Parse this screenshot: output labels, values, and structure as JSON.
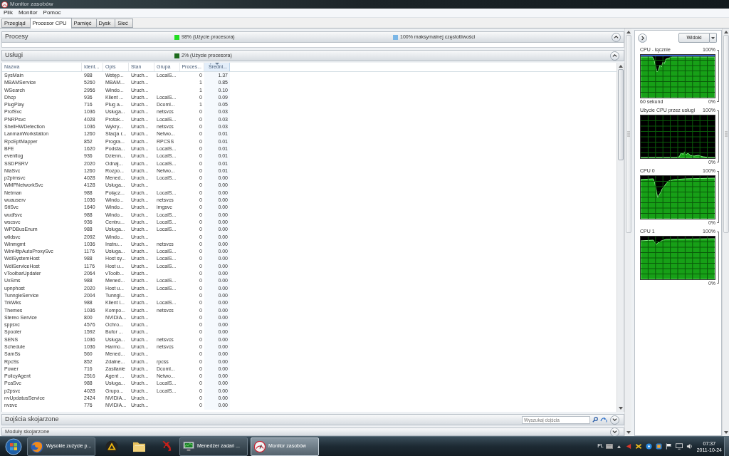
{
  "window": {
    "title": "Monitor zasobów"
  },
  "menu": [
    "Plik",
    "Monitor",
    "Pomoc"
  ],
  "tabs": [
    {
      "label": "Przegląd",
      "selected": false
    },
    {
      "label": "Procesor CPU",
      "selected": true
    },
    {
      "label": "Pamięć",
      "selected": false
    },
    {
      "label": "Dysk",
      "selected": false
    },
    {
      "label": "Sieć",
      "selected": false
    }
  ],
  "processes": {
    "title": "Procesy",
    "expanded": true,
    "legend": [
      {
        "text": "98% (Użycie procesora)",
        "color": "#22dd22"
      },
      {
        "text": "100% maksymalnej częstotliwości",
        "color": "#7ab6e6"
      }
    ]
  },
  "services": {
    "title": "Usługi",
    "expanded": true,
    "legend": [
      {
        "text": "2% (Użycie procesora)",
        "color": "#1d6b1d"
      }
    ],
    "columns": [
      {
        "label": "Nazwa",
        "sorted": false
      },
      {
        "label": "Ident...",
        "sorted": false
      },
      {
        "label": "Opis",
        "sorted": false
      },
      {
        "label": "Stan",
        "sorted": false
      },
      {
        "label": "Grupa",
        "sorted": false
      },
      {
        "label": "Proces...",
        "sorted": false
      },
      {
        "label": "Średni...",
        "sorted": true
      }
    ],
    "rows": [
      {
        "name": "SysMain",
        "ident": "988",
        "opis": "Wstęp...",
        "stan": "Uruch...",
        "grupa": "LocalS...",
        "proces": "0",
        "sredni": "1.37"
      },
      {
        "name": "MBAMService",
        "ident": "5260",
        "opis": "MBAM...",
        "stan": "Uruch...",
        "proces": "1",
        "sredni": "0.85"
      },
      {
        "name": "WSearch",
        "ident": "2956",
        "opis": "Windo...",
        "stan": "Uruch...",
        "proces": "1",
        "sredni": "0.10"
      },
      {
        "name": "Dhcp",
        "ident": "936",
        "opis": "Klient ...",
        "stan": "Uruch...",
        "grupa": "LocalS...",
        "proces": "0",
        "sredni": "0.09"
      },
      {
        "name": "PlugPlay",
        "ident": "716",
        "opis": "Plug a...",
        "stan": "Uruch...",
        "grupa": "Dcoml...",
        "proces": "1",
        "sredni": "0.05"
      },
      {
        "name": "ProfSvc",
        "ident": "1036",
        "opis": "Usługa...",
        "stan": "Uruch...",
        "grupa": "netsvcs",
        "proces": "0",
        "sredni": "0.03"
      },
      {
        "name": "PNRPsvc",
        "ident": "4028",
        "opis": "Protok...",
        "stan": "Uruch...",
        "grupa": "LocalS...",
        "proces": "0",
        "sredni": "0.03"
      },
      {
        "name": "ShellHWDetection",
        "ident": "1036",
        "opis": "Wykry...",
        "stan": "Uruch...",
        "grupa": "netsvcs",
        "proces": "0",
        "sredni": "0.03"
      },
      {
        "name": "LanmanWorkstation",
        "ident": "1260",
        "opis": "Stacja r...",
        "stan": "Uruch...",
        "grupa": "Netwo...",
        "proces": "0",
        "sredni": "0.01"
      },
      {
        "name": "RpcEptMapper",
        "ident": "852",
        "opis": "Progra...",
        "stan": "Uruch...",
        "grupa": "RPCSS",
        "proces": "0",
        "sredni": "0.01"
      },
      {
        "name": "BFE",
        "ident": "1620",
        "opis": "Podsta...",
        "stan": "Uruch...",
        "grupa": "LocalS...",
        "proces": "0",
        "sredni": "0.01"
      },
      {
        "name": "eventlog",
        "ident": "936",
        "opis": "Dzienn...",
        "stan": "Uruch...",
        "grupa": "LocalS...",
        "proces": "0",
        "sredni": "0.01"
      },
      {
        "name": "SSDPSRV",
        "ident": "2020",
        "opis": "Odnaj...",
        "stan": "Uruch...",
        "grupa": "LocalS...",
        "proces": "0",
        "sredni": "0.01"
      },
      {
        "name": "NlaSvc",
        "ident": "1260",
        "opis": "Rozpo...",
        "stan": "Uruch...",
        "grupa": "Netwo...",
        "proces": "0",
        "sredni": "0.01"
      },
      {
        "name": "p2pimsvc",
        "ident": "4028",
        "opis": "Mened...",
        "stan": "Uruch...",
        "grupa": "LocalS...",
        "proces": "0",
        "sredni": "0.00"
      },
      {
        "name": "WMPNetworkSvc",
        "ident": "4128",
        "opis": "Usługa...",
        "stan": "Uruch...",
        "proces": "0",
        "sredni": "0.00"
      },
      {
        "name": "Netman",
        "ident": "988",
        "opis": "Połącz...",
        "stan": "Uruch...",
        "grupa": "LocalS...",
        "proces": "0",
        "sredni": "0.00"
      },
      {
        "name": "wuauserv",
        "ident": "1036",
        "opis": "Windo...",
        "stan": "Uruch...",
        "grupa": "netsvcs",
        "proces": "0",
        "sredni": "0.00"
      },
      {
        "name": "StiSvc",
        "ident": "1640",
        "opis": "Windo...",
        "stan": "Uruch...",
        "grupa": "imgsvc",
        "proces": "0",
        "sredni": "0.00"
      },
      {
        "name": "wudfsvc",
        "ident": "988",
        "opis": "Windo...",
        "stan": "Uruch...",
        "grupa": "LocalS...",
        "proces": "0",
        "sredni": "0.00"
      },
      {
        "name": "wscsvc",
        "ident": "936",
        "opis": "Centru...",
        "stan": "Uruch...",
        "grupa": "LocalS...",
        "proces": "0",
        "sredni": "0.00"
      },
      {
        "name": "WPDBusEnum",
        "ident": "988",
        "opis": "Usługa...",
        "stan": "Uruch...",
        "grupa": "LocalS...",
        "proces": "0",
        "sredni": "0.00"
      },
      {
        "name": "wlidsvc",
        "ident": "2092",
        "opis": "Windo...",
        "stan": "Uruch...",
        "proces": "0",
        "sredni": "0.00"
      },
      {
        "name": "Winmgmt",
        "ident": "1036",
        "opis": "Instru...",
        "stan": "Uruch...",
        "grupa": "netsvcs",
        "proces": "0",
        "sredni": "0.00"
      },
      {
        "name": "WinHttpAutoProxySvc",
        "ident": "1176",
        "opis": "Usługa...",
        "stan": "Uruch...",
        "grupa": "LocalS...",
        "proces": "0",
        "sredni": "0.00"
      },
      {
        "name": "WdiSystemHost",
        "ident": "988",
        "opis": "Host sy...",
        "stan": "Uruch...",
        "grupa": "LocalS...",
        "proces": "0",
        "sredni": "0.00"
      },
      {
        "name": "WdiServiceHost",
        "ident": "1176",
        "opis": "Host u...",
        "stan": "Uruch...",
        "grupa": "LocalS...",
        "proces": "0",
        "sredni": "0.00"
      },
      {
        "name": "vToolbarUpdater",
        "ident": "2064",
        "opis": "vToolb...",
        "stan": "Uruch...",
        "proces": "0",
        "sredni": "0.00"
      },
      {
        "name": "UxSms",
        "ident": "988",
        "opis": "Mened...",
        "stan": "Uruch...",
        "grupa": "LocalS...",
        "proces": "0",
        "sredni": "0.00"
      },
      {
        "name": "upnphost",
        "ident": "2020",
        "opis": "Host u...",
        "stan": "Uruch...",
        "grupa": "LocalS...",
        "proces": "0",
        "sredni": "0.00"
      },
      {
        "name": "TunngleService",
        "ident": "2004",
        "opis": "Tunngl...",
        "stan": "Uruch...",
        "proces": "0",
        "sredni": "0.00"
      },
      {
        "name": "TrkWks",
        "ident": "988",
        "opis": "Klient l...",
        "stan": "Uruch...",
        "grupa": "LocalS...",
        "proces": "0",
        "sredni": "0.00"
      },
      {
        "name": "Themes",
        "ident": "1036",
        "opis": "Kompo...",
        "stan": "Uruch...",
        "grupa": "netsvcs",
        "proces": "0",
        "sredni": "0.00"
      },
      {
        "name": "Stereo Service",
        "ident": "800",
        "opis": "NVIDIA...",
        "stan": "Uruch...",
        "proces": "0",
        "sredni": "0.00"
      },
      {
        "name": "sppsvc",
        "ident": "4576",
        "opis": "Ochro...",
        "stan": "Uruch...",
        "proces": "0",
        "sredni": "0.00"
      },
      {
        "name": "Spooler",
        "ident": "1592",
        "opis": "Bufor ...",
        "stan": "Uruch...",
        "proces": "0",
        "sredni": "0.00"
      },
      {
        "name": "SENS",
        "ident": "1036",
        "opis": "Usługa...",
        "stan": "Uruch...",
        "grupa": "netsvcs",
        "proces": "0",
        "sredni": "0.00"
      },
      {
        "name": "Schedule",
        "ident": "1036",
        "opis": "Harmo...",
        "stan": "Uruch...",
        "grupa": "netsvcs",
        "proces": "0",
        "sredni": "0.00"
      },
      {
        "name": "SamSs",
        "ident": "560",
        "opis": "Mened...",
        "stan": "Uruch...",
        "proces": "0",
        "sredni": "0.00"
      },
      {
        "name": "RpcSs",
        "ident": "852",
        "opis": "Zdalne...",
        "stan": "Uruch...",
        "grupa": "rpcss",
        "proces": "0",
        "sredni": "0.00"
      },
      {
        "name": "Power",
        "ident": "716",
        "opis": "Zasilanie",
        "stan": "Uruch...",
        "grupa": "Dcoml...",
        "proces": "0",
        "sredni": "0.00"
      },
      {
        "name": "PolicyAgent",
        "ident": "2516",
        "opis": "Agent ...",
        "stan": "Uruch...",
        "grupa": "Netwo...",
        "proces": "0",
        "sredni": "0.00"
      },
      {
        "name": "PcaSvc",
        "ident": "988",
        "opis": "Usługa...",
        "stan": "Uruch...",
        "grupa": "LocalS...",
        "proces": "0",
        "sredni": "0.00"
      },
      {
        "name": "p2psvc",
        "ident": "4028",
        "opis": "Grupo...",
        "stan": "Uruch...",
        "grupa": "LocalS...",
        "proces": "0",
        "sredni": "0.00"
      },
      {
        "name": "nvUpdatusService",
        "ident": "2424",
        "opis": "NVIDIA...",
        "stan": "Uruch...",
        "proces": "0",
        "sredni": "0.00"
      },
      {
        "name": "nvsvc",
        "ident": "776",
        "opis": "NVIDIA...",
        "stan": "Uruch...",
        "proces": "0",
        "sredni": "0.00"
      }
    ]
  },
  "handles": {
    "title": "Dojścia skojarzone",
    "expanded": false,
    "search": {
      "placeholder": "Wyszukaj dojścia"
    }
  },
  "modules": {
    "title": "Moduły skojarzone",
    "expanded": false
  },
  "side_panel": {
    "views_button": "Widoki",
    "graphs": [
      {
        "title": "CPU - łącznie",
        "max": "100%",
        "min": "0%",
        "footer": "60 sekund"
      },
      {
        "title": "Użycie CPU przez usługi",
        "max": "100%",
        "min": "0%"
      },
      {
        "title": "CPU 0",
        "max": "100%",
        "min": "0%"
      },
      {
        "title": "CPU 1",
        "max": "100%",
        "min": "0%"
      }
    ]
  },
  "taskbar": {
    "items": [
      {
        "kind": "browser",
        "label": "Wysokie zużycie p...",
        "selected": false
      },
      {
        "kind": "triangle",
        "selected": false
      },
      {
        "kind": "folder",
        "selected": false
      },
      {
        "kind": "figure",
        "selected": false
      },
      {
        "kind": "task-manager",
        "label": "Menedżer zadań ...",
        "selected": false
      },
      {
        "kind": "resource-monitor",
        "label": "Monitor zasobów",
        "selected": true
      }
    ],
    "language": "PL",
    "time": "07:37",
    "date": "2011-10-24"
  }
}
